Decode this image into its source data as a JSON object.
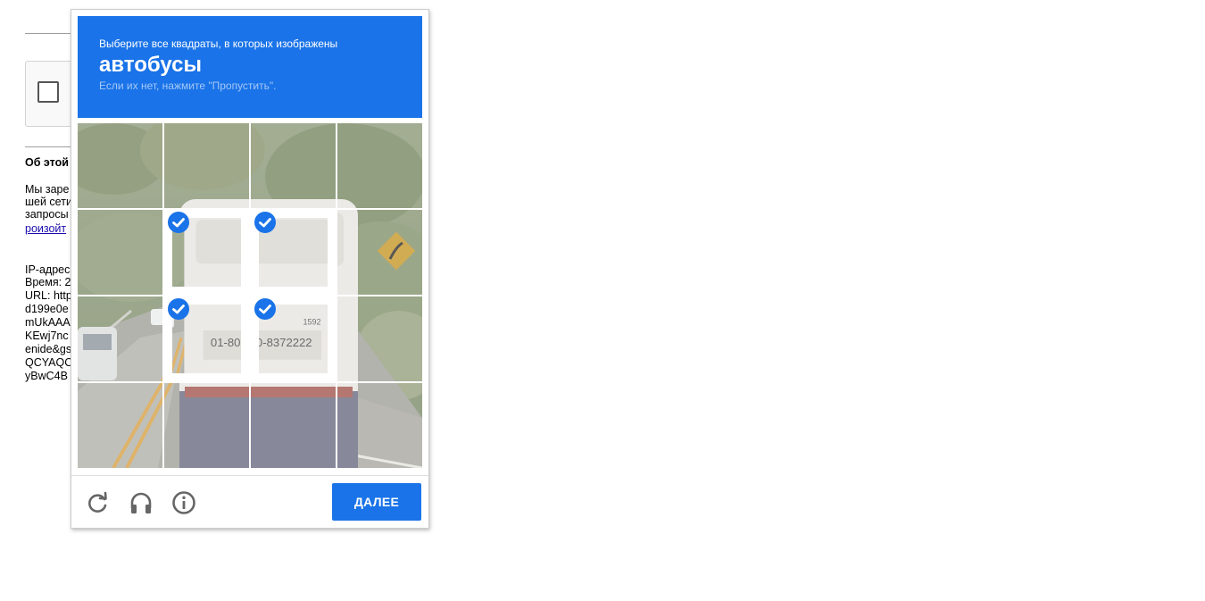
{
  "background": {
    "section_title": "Об этой",
    "para_lines": [
      "Мы заре",
      "шей сети",
      "запросы",
      "роизойт"
    ],
    "info_lines": [
      "IP-адрес",
      "Время: 2",
      "URL: http",
      "d199e0e",
      "mUkAAA",
      "KEwj7nc",
      "enide&gs",
      "QCYAQC",
      "yBwC4B"
    ]
  },
  "captcha": {
    "instruction": "Выберите все квадраты, в которых изображены",
    "target": "автобусы",
    "hint": "Если их нет, нажмите \"Пропустить\".",
    "next_label": "ДАЛЕЕ",
    "selected_tiles": [
      5,
      6,
      9,
      10
    ],
    "colors": {
      "accent": "#1a73e8",
      "hint": "#a5c8f7"
    },
    "icons": [
      "reload-icon",
      "audio-icon",
      "info-icon"
    ]
  }
}
